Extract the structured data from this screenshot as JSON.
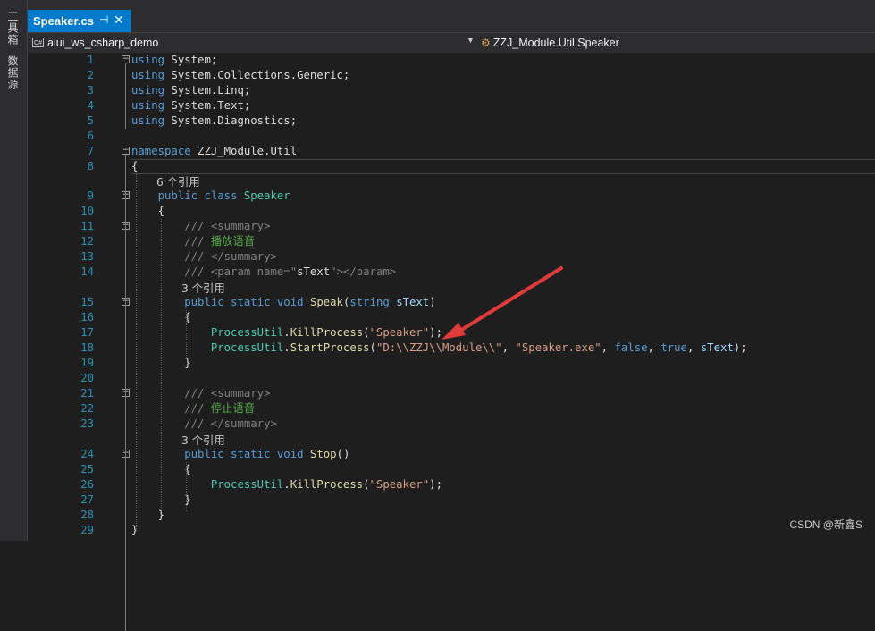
{
  "side_tabs": [
    "工具箱",
    "数据源"
  ],
  "tab": {
    "title": "Speaker.cs",
    "pin": "⊣",
    "close": "✕"
  },
  "nav": {
    "project": "aiui_ws_csharp_demo",
    "scope": "ZZJ_Module.Util.Speaker"
  },
  "lens": {
    "class_refs": "6 个引用",
    "speak_refs": "3 个引用",
    "stop_refs": "3 个引用"
  },
  "lines": [
    {
      "n": "1",
      "segs": [
        [
          "kw",
          "using"
        ],
        [
          "pl",
          " System;"
        ]
      ]
    },
    {
      "n": "2",
      "segs": [
        [
          "kw",
          "using"
        ],
        [
          "pl",
          " System.Collections.Generic;"
        ]
      ]
    },
    {
      "n": "3",
      "segs": [
        [
          "kw",
          "using"
        ],
        [
          "pl",
          " System.Linq;"
        ]
      ]
    },
    {
      "n": "4",
      "segs": [
        [
          "kw",
          "using"
        ],
        [
          "pl",
          " System.Text;"
        ]
      ]
    },
    {
      "n": "5",
      "segs": [
        [
          "kw",
          "using"
        ],
        [
          "pl",
          " System.Diagnostics;"
        ]
      ]
    },
    {
      "n": "6",
      "segs": []
    },
    {
      "n": "7",
      "segs": [
        [
          "kw",
          "namespace"
        ],
        [
          "pl",
          " ZZJ_Module.Util"
        ]
      ]
    },
    {
      "n": "8",
      "segs": [
        [
          "pl",
          "{"
        ]
      ]
    },
    {
      "n": "9",
      "segs": [
        [
          "pl",
          "    "
        ],
        [
          "kw",
          "public"
        ],
        [
          "pl",
          " "
        ],
        [
          "kw",
          "class"
        ],
        [
          "pl",
          " "
        ],
        [
          "ty",
          "Speaker"
        ]
      ]
    },
    {
      "n": "10",
      "segs": [
        [
          "pl",
          "    {"
        ]
      ]
    },
    {
      "n": "11",
      "segs": [
        [
          "pl",
          "        "
        ],
        [
          "gl",
          "/// <summary>"
        ]
      ]
    },
    {
      "n": "12",
      "segs": [
        [
          "pl",
          "        "
        ],
        [
          "gl",
          "///"
        ],
        [
          "cm",
          " 播放语音"
        ]
      ]
    },
    {
      "n": "13",
      "segs": [
        [
          "pl",
          "        "
        ],
        [
          "gl",
          "/// </summary>"
        ]
      ]
    },
    {
      "n": "14",
      "segs": [
        [
          "pl",
          "        "
        ],
        [
          "gl",
          "/// <param name=\""
        ],
        [
          "pl",
          "sText"
        ],
        [
          "gl",
          "\"></param>"
        ]
      ]
    },
    {
      "n": "15",
      "segs": [
        [
          "pl",
          "        "
        ],
        [
          "kw",
          "public"
        ],
        [
          "pl",
          " "
        ],
        [
          "kw",
          "static"
        ],
        [
          "pl",
          " "
        ],
        [
          "kw",
          "void"
        ],
        [
          "pl",
          " "
        ],
        [
          "fn",
          "Speak"
        ],
        [
          "pl",
          "("
        ],
        [
          "kw",
          "string"
        ],
        [
          "pl",
          " "
        ],
        [
          "pa",
          "sText"
        ],
        [
          "pl",
          ")"
        ]
      ]
    },
    {
      "n": "16",
      "segs": [
        [
          "pl",
          "        {"
        ]
      ]
    },
    {
      "n": "17",
      "segs": [
        [
          "pl",
          "            "
        ],
        [
          "ty",
          "ProcessUtil"
        ],
        [
          "pl",
          "."
        ],
        [
          "fn",
          "KillProcess"
        ],
        [
          "pl",
          "("
        ],
        [
          "st",
          "\"Speaker\""
        ],
        [
          "pl",
          ");"
        ]
      ]
    },
    {
      "n": "18",
      "segs": [
        [
          "pl",
          "            "
        ],
        [
          "ty",
          "ProcessUtil"
        ],
        [
          "pl",
          "."
        ],
        [
          "fn",
          "StartProcess"
        ],
        [
          "pl",
          "("
        ],
        [
          "st",
          "\"D:\\\\ZZJ\\\\Module\\\\\""
        ],
        [
          "pl",
          ", "
        ],
        [
          "st",
          "\"Speaker.exe\""
        ],
        [
          "pl",
          ", "
        ],
        [
          "kw",
          "false"
        ],
        [
          "pl",
          ", "
        ],
        [
          "kw",
          "true"
        ],
        [
          "pl",
          ", "
        ],
        [
          "pa",
          "sText"
        ],
        [
          "pl",
          ");"
        ]
      ]
    },
    {
      "n": "19",
      "segs": [
        [
          "pl",
          "        }"
        ]
      ]
    },
    {
      "n": "20",
      "segs": []
    },
    {
      "n": "21",
      "segs": [
        [
          "pl",
          "        "
        ],
        [
          "gl",
          "/// <summary>"
        ]
      ]
    },
    {
      "n": "22",
      "segs": [
        [
          "pl",
          "        "
        ],
        [
          "gl",
          "///"
        ],
        [
          "cm",
          " 停止语音"
        ]
      ]
    },
    {
      "n": "23",
      "segs": [
        [
          "pl",
          "        "
        ],
        [
          "gl",
          "/// </summary>"
        ]
      ]
    },
    {
      "n": "24",
      "segs": [
        [
          "pl",
          "        "
        ],
        [
          "kw",
          "public"
        ],
        [
          "pl",
          " "
        ],
        [
          "kw",
          "static"
        ],
        [
          "pl",
          " "
        ],
        [
          "kw",
          "void"
        ],
        [
          "pl",
          " "
        ],
        [
          "fn",
          "Stop"
        ],
        [
          "pl",
          "()"
        ]
      ]
    },
    {
      "n": "25",
      "segs": [
        [
          "pl",
          "        {"
        ]
      ]
    },
    {
      "n": "26",
      "segs": [
        [
          "pl",
          "            "
        ],
        [
          "ty",
          "ProcessUtil"
        ],
        [
          "pl",
          "."
        ],
        [
          "fn",
          "KillProcess"
        ],
        [
          "pl",
          "("
        ],
        [
          "st",
          "\"Speaker\""
        ],
        [
          "pl",
          ");"
        ]
      ]
    },
    {
      "n": "27",
      "segs": [
        [
          "pl",
          "        }"
        ]
      ]
    },
    {
      "n": "28",
      "segs": [
        [
          "pl",
          "    }"
        ]
      ]
    },
    {
      "n": "29",
      "segs": [
        [
          "pl",
          "}"
        ]
      ]
    }
  ],
  "watermark": "CSDN @新鑫S",
  "colors": {
    "accent": "#007acc",
    "arrow": "#e03a3a",
    "bg": "#1e1e1e"
  }
}
